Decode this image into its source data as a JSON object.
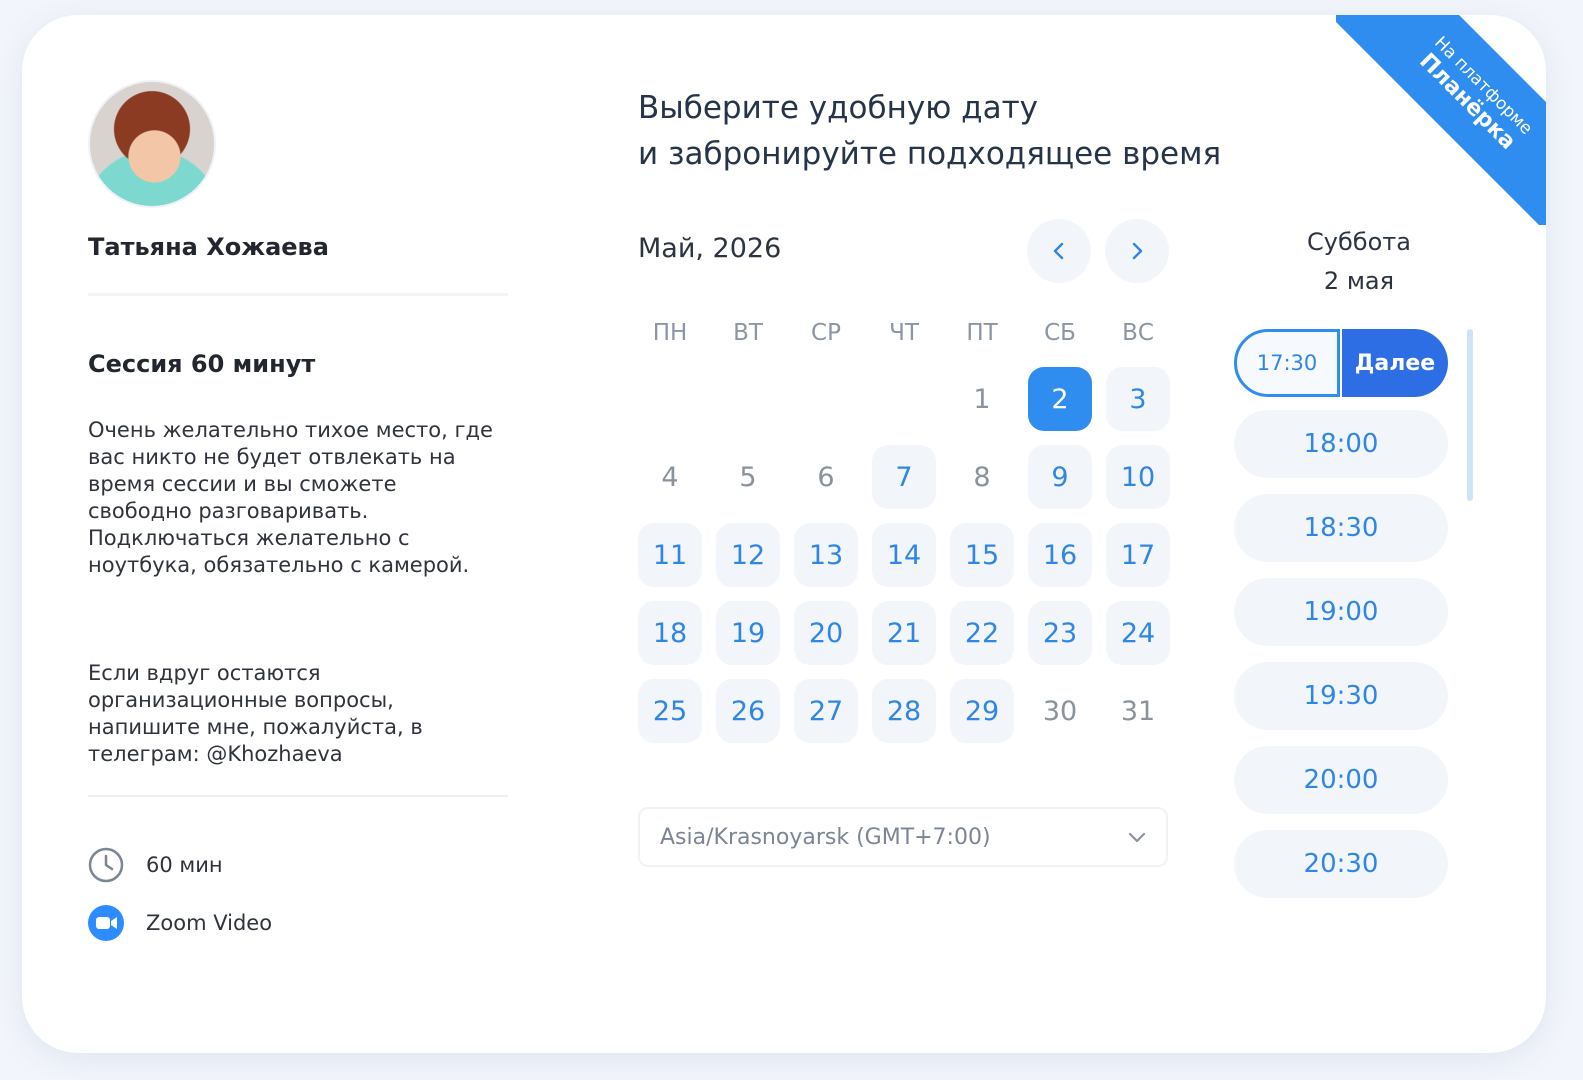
{
  "ribbon": {
    "line1": "На платформе",
    "line2": "Планёрка"
  },
  "profile": {
    "name": "Татьяна Хожаева"
  },
  "session": {
    "title": "Сессия 60 минут",
    "description": "Очень желательно тихое место, где\nвас никто не будет отвлекать на\nвремя сессии и вы сможете\nсвободно разговаривать.\nПодключаться желательно с\nноутбука, обязательно с камерой.",
    "note": "Если вдруг остаются\nорганизационные вопросы,\nнапишите мне, пожалуйста, в\nтелеграм: @Khozhaeva",
    "duration": "60 мин",
    "platform": "Zoom Video"
  },
  "heading": {
    "line1": "Выберите удобную дату",
    "line2": "и забронируйте подходящее время"
  },
  "calendar": {
    "month_label": "Май, 2026",
    "weekdays": [
      "ПН",
      "ВТ",
      "СР",
      "ЧТ",
      "ПТ",
      "СБ",
      "ВС"
    ],
    "first_weekday_index": 4,
    "days": [
      {
        "n": "1",
        "state": "plain"
      },
      {
        "n": "2",
        "state": "selected"
      },
      {
        "n": "3",
        "state": "available"
      },
      {
        "n": "4",
        "state": "plain"
      },
      {
        "n": "5",
        "state": "plain"
      },
      {
        "n": "6",
        "state": "plain"
      },
      {
        "n": "7",
        "state": "available"
      },
      {
        "n": "8",
        "state": "plain"
      },
      {
        "n": "9",
        "state": "available"
      },
      {
        "n": "10",
        "state": "available"
      },
      {
        "n": "11",
        "state": "available"
      },
      {
        "n": "12",
        "state": "available"
      },
      {
        "n": "13",
        "state": "available"
      },
      {
        "n": "14",
        "state": "available"
      },
      {
        "n": "15",
        "state": "available"
      },
      {
        "n": "16",
        "state": "available"
      },
      {
        "n": "17",
        "state": "available"
      },
      {
        "n": "18",
        "state": "available"
      },
      {
        "n": "19",
        "state": "available"
      },
      {
        "n": "20",
        "state": "available"
      },
      {
        "n": "21",
        "state": "available"
      },
      {
        "n": "22",
        "state": "available"
      },
      {
        "n": "23",
        "state": "available"
      },
      {
        "n": "24",
        "state": "available"
      },
      {
        "n": "25",
        "state": "available"
      },
      {
        "n": "26",
        "state": "available"
      },
      {
        "n": "27",
        "state": "available"
      },
      {
        "n": "28",
        "state": "available"
      },
      {
        "n": "29",
        "state": "available"
      },
      {
        "n": "30",
        "state": "plain"
      },
      {
        "n": "31",
        "state": "plain"
      }
    ],
    "timezone": "Asia/Krasnoyarsk (GMT+7:00)"
  },
  "slots": {
    "day_name": "Суббота",
    "day_date": "2 мая",
    "selected_time": "17:30",
    "next_label": "Далее",
    "times": [
      "18:00",
      "18:30",
      "19:00",
      "19:30",
      "20:00",
      "20:30"
    ]
  },
  "colors": {
    "accent": "#2f8df0",
    "next_button": "#2d6ee4",
    "available_bg": "#f2f6fb"
  }
}
